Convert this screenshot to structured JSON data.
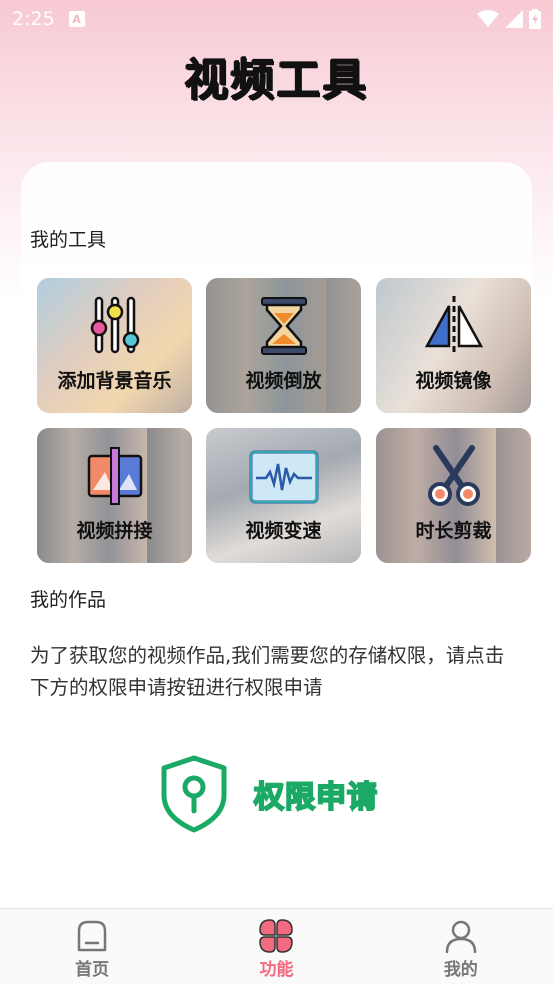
{
  "status_bar": {
    "time": "2:25",
    "notif_letter": "A"
  },
  "header": {
    "title": "视频工具"
  },
  "tools_section": {
    "title": "我的工具",
    "items": [
      {
        "label": "添加背景音乐",
        "icon": "equalizer-sliders-icon"
      },
      {
        "label": "视频倒放",
        "icon": "hourglass-icon"
      },
      {
        "label": "视频镜像",
        "icon": "mirror-flip-icon"
      },
      {
        "label": "视频拼接",
        "icon": "video-splice-icon"
      },
      {
        "label": "视频变速",
        "icon": "waveform-speed-icon"
      },
      {
        "label": "时长剪裁",
        "icon": "scissors-icon"
      }
    ]
  },
  "works_section": {
    "title": "我的作品",
    "description": "为了获取您的视频作品,我们需要您的存储权限，请点击下方的权限申请按钮进行权限申请",
    "permission_button": "权限申请"
  },
  "bottom_nav": {
    "items": [
      {
        "label": "首页",
        "icon": "home-icon",
        "active": false
      },
      {
        "label": "功能",
        "icon": "clover-grid-icon",
        "active": true
      },
      {
        "label": "我的",
        "icon": "person-icon",
        "active": false
      }
    ]
  },
  "colors": {
    "accent": "#f26a80",
    "permission_green": "#1aaa66",
    "header_pink": "#f7c9d3"
  }
}
